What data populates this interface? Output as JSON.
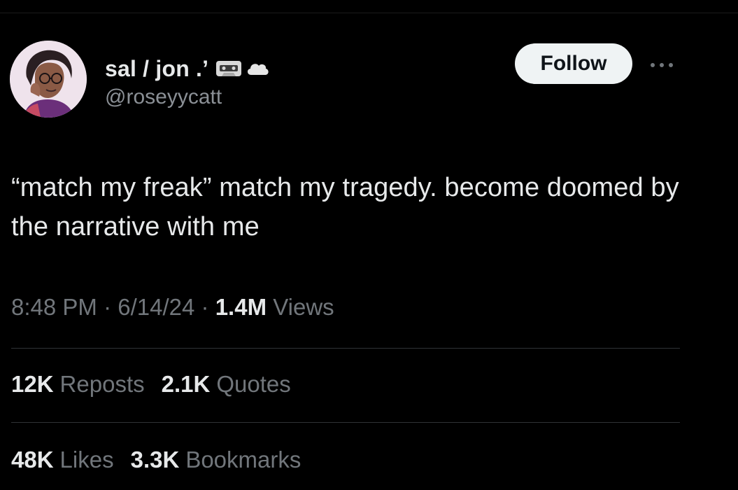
{
  "author": {
    "display_name": "sal / jon .’",
    "handle": "@roseyycatt",
    "name_emoji": [
      "cassette-tape-icon",
      "cloud-icon"
    ]
  },
  "actions": {
    "follow_label": "Follow",
    "more_icon": "more-dots-icon"
  },
  "tweet": {
    "text": "“match my freak” match my tragedy. become doomed by the narrative with me"
  },
  "meta": {
    "time": "8:48 PM",
    "separator": "·",
    "date": "6/14/24",
    "views_count": "1.4M",
    "views_label": "Views"
  },
  "stats_row1": [
    {
      "count": "12K",
      "label": "Reposts"
    },
    {
      "count": "2.1K",
      "label": "Quotes"
    }
  ],
  "stats_row2": [
    {
      "count": "48K",
      "label": "Likes"
    },
    {
      "count": "3.3K",
      "label": "Bookmarks"
    }
  ],
  "colors": {
    "background": "#000000",
    "text_primary": "#e7e9ea",
    "text_secondary": "#71767b",
    "divider": "#2f3336",
    "follow_bg": "#eff3f4"
  }
}
